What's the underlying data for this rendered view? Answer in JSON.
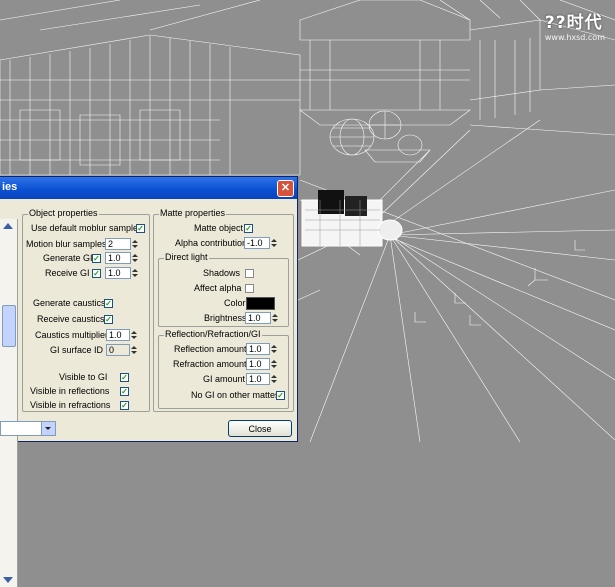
{
  "watermark": {
    "logo": "??时代",
    "url": "www.hxsd.com"
  },
  "dialog": {
    "title": "ies",
    "close_glyph": "✕",
    "object_properties": {
      "title": "Object properties",
      "use_default_moblur": {
        "label": "Use default moblur samples",
        "checked": true
      },
      "motion_blur_samples": {
        "label": "Motion blur samples",
        "value": "2"
      },
      "generate_gi": {
        "label": "Generate GI",
        "checked": true,
        "value": "1.0"
      },
      "receive_gi": {
        "label": "Receive GI",
        "checked": true,
        "value": "1.0"
      },
      "generate_caustics": {
        "label": "Generate caustics",
        "checked": true
      },
      "receive_caustics": {
        "label": "Receive caustics",
        "checked": true
      },
      "caustics_multiplier": {
        "label": "Caustics multiplier",
        "value": "1.0"
      },
      "gi_surface_id": {
        "label": "GI surface ID",
        "value": "0"
      },
      "visible_to_gi": {
        "label": "Visible to GI",
        "checked": true
      },
      "visible_in_reflections": {
        "label": "Visible in reflections",
        "checked": true
      },
      "visible_in_refractions": {
        "label": "Visible in refractions",
        "checked": true
      }
    },
    "matte_properties": {
      "title": "Matte properties",
      "matte_object": {
        "label": "Matte object",
        "checked": true
      },
      "alpha_contribution": {
        "label": "Alpha contribution",
        "value": "-1.0"
      },
      "direct_light": {
        "title": "Direct light",
        "shadows": {
          "label": "Shadows",
          "checked": false
        },
        "affect_alpha": {
          "label": "Affect alpha",
          "checked": false
        },
        "color": {
          "label": "Color",
          "value": "#000000"
        },
        "brightness": {
          "label": "Brightness",
          "value": "1.0"
        }
      },
      "reflection": {
        "title": "Reflection/Refraction/GI",
        "reflection_amount": {
          "label": "Reflection amount",
          "value": "1.0"
        },
        "refraction_amount": {
          "label": "Refraction amount",
          "value": "1.0"
        },
        "gi_amount": {
          "label": "GI amount",
          "value": "1.0"
        },
        "no_gi_other_mattes": {
          "label": "No GI on other mattes",
          "checked": true
        }
      }
    },
    "close_button": "Close"
  }
}
